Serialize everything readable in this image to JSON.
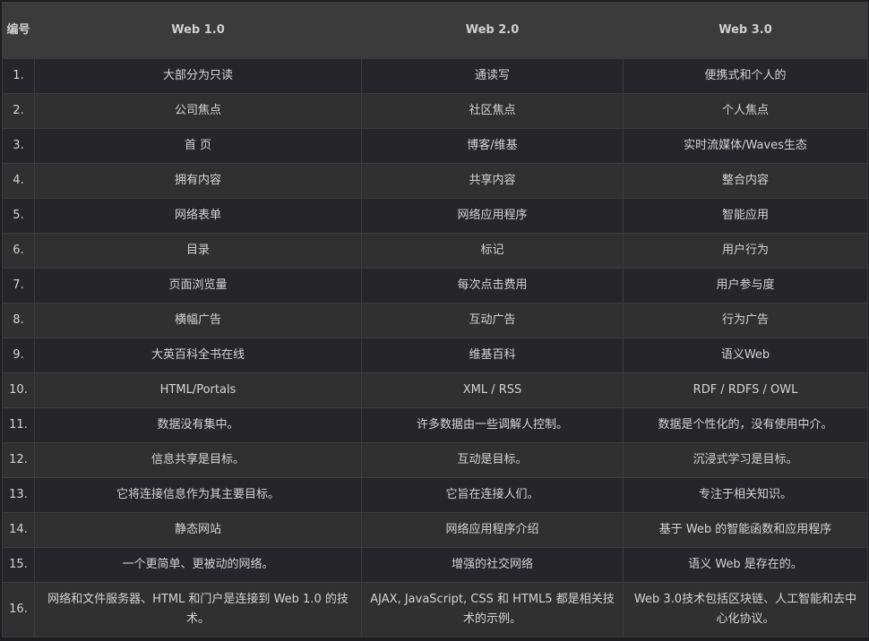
{
  "table": {
    "headers": [
      "编号",
      "Web 1.0",
      "Web 2.0",
      "Web 3.0"
    ],
    "rows": [
      [
        "1.",
        "大部分为只读",
        "通读写",
        "便携式和个人的"
      ],
      [
        "2.",
        "公司焦点",
        "社区焦点",
        "个人焦点"
      ],
      [
        "3.",
        "首 页",
        "博客/维基",
        "实时流媒体/Waves生态"
      ],
      [
        "4.",
        "拥有内容",
        "共享内容",
        "整合内容"
      ],
      [
        "5.",
        "网络表单",
        "网络应用程序",
        "智能应用"
      ],
      [
        "6.",
        "目录",
        "标记",
        "用户行为"
      ],
      [
        "7.",
        "页面浏览量",
        "每次点击费用",
        "用户参与度"
      ],
      [
        "8.",
        "横幅广告",
        "互动广告",
        "行为广告"
      ],
      [
        "9.",
        "大英百科全书在线",
        "维基百科",
        "语义Web"
      ],
      [
        "10.",
        "HTML/Portals",
        "XML / RSS",
        "RDF / RDFS / OWL"
      ],
      [
        "11.",
        "数据没有集中。",
        "许多数据由一些调解人控制。",
        "数据是个性化的，没有使用中介。"
      ],
      [
        "12.",
        "信息共享是目标。",
        "互动是目标。",
        "沉浸式学习是目标。"
      ],
      [
        "13.",
        "它将连接信息作为其主要目标。",
        "它旨在连接人们。",
        "专注于相关知识。"
      ],
      [
        "14.",
        "静态网站",
        "网络应用程序介绍",
        "基于 Web 的智能函数和应用程序"
      ],
      [
        "15.",
        "一个更简单、更被动的网络。",
        "增强的社交网络",
        "语义 Web 是存在的。"
      ],
      [
        "16.",
        "网络和文件服务器、HTML 和门户是连接到 Web 1.0 的技术。",
        "AJAX, JavaScript, CSS 和 HTML5 都是相关技术的示例。",
        "Web 3.0技术包括区块链、人工智能和去中心化协议。"
      ]
    ]
  }
}
